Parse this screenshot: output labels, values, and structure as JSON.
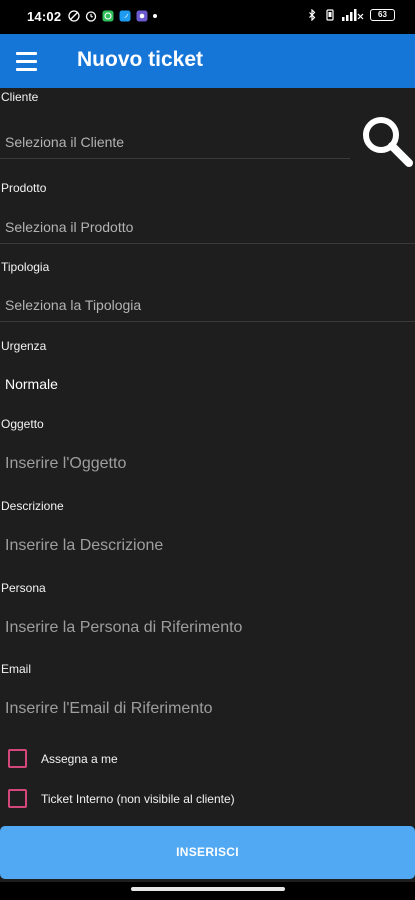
{
  "status_bar": {
    "time": "14:02",
    "battery": "63",
    "left_icons": [
      "do-not-disturb-icon",
      "alarm-icon",
      "whatsapp-icon",
      "twitter-icon",
      "app-notification-icon",
      "dot-icon"
    ],
    "right_icons": [
      "bluetooth-icon",
      "vibrate-icon",
      "signal-icon",
      "battery-icon"
    ]
  },
  "app_bar": {
    "title": "Nuovo ticket",
    "menu_icon": "hamburger-menu-icon",
    "color": "#1676d8"
  },
  "form": {
    "cliente": {
      "label": "Cliente",
      "placeholder": "Seleziona il Cliente"
    },
    "prodotto": {
      "label": "Prodotto",
      "placeholder": "Seleziona il Prodotto"
    },
    "tipologia": {
      "label": "Tipologia",
      "placeholder": "Seleziona la Tipologia"
    },
    "urgenza": {
      "label": "Urgenza",
      "value": "Normale"
    },
    "oggetto": {
      "label": "Oggetto",
      "placeholder": "Inserire l'Oggetto"
    },
    "descrizione": {
      "label": "Descrizione",
      "placeholder": "Inserire la Descrizione"
    },
    "persona": {
      "label": "Persona",
      "placeholder": "Inserire la Persona di Riferimento"
    },
    "email": {
      "label": "Email",
      "placeholder": "Inserire l'Email di Riferimento"
    }
  },
  "checkboxes": {
    "assegna": {
      "label": "Assegna a me",
      "checked": false
    },
    "interno": {
      "label": "Ticket Interno (non visibile al cliente)",
      "checked": false
    }
  },
  "submit": {
    "label": "INSERISCI",
    "color": "#51a8f3"
  },
  "colors": {
    "checkbox_border": "#d4477a",
    "background": "#1e1e1e"
  }
}
